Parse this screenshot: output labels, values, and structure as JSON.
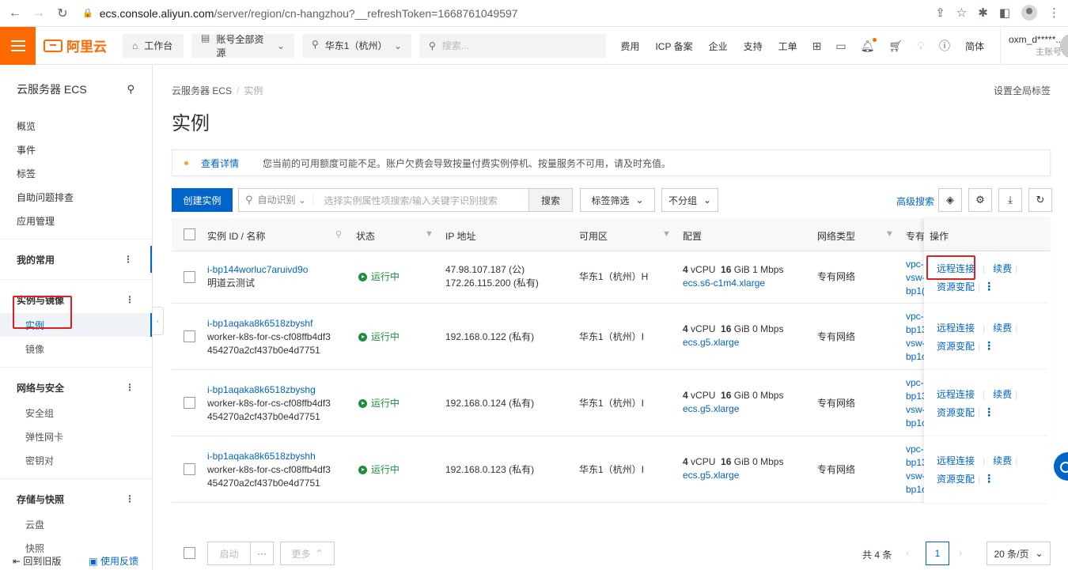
{
  "browser": {
    "url_host": "ecs.console.aliyun.com",
    "url_path": "/server/region/cn-hangzhou?__refreshToken=1668761049597"
  },
  "topbar": {
    "logo": "阿里云",
    "workbench": "工作台",
    "resources": "账号全部资源",
    "region": "华东1（杭州）",
    "search_placeholder": "搜索...",
    "links": [
      "费用",
      "ICP 备案",
      "企业",
      "支持",
      "工单"
    ],
    "lang": "简体",
    "user_name": "oxm_d*****...",
    "user_role": "主账号"
  },
  "sidebar": {
    "title": "云服务器 ECS",
    "top_items": [
      "概览",
      "事件",
      "标签",
      "自助问题排查",
      "应用管理"
    ],
    "favorites": "我的常用",
    "group_instance": "实例与镜像",
    "instance_items": [
      "实例",
      "镜像"
    ],
    "group_network": "网络与安全",
    "network_items": [
      "安全组",
      "弹性网卡",
      "密钥对"
    ],
    "group_storage": "存储与快照",
    "storage_items": [
      "云盘",
      "快照"
    ],
    "footer_old": "回到旧版",
    "footer_feedback": "使用反馈"
  },
  "main": {
    "breadcrumb_root": "云服务器 ECS",
    "breadcrumb_current": "实例",
    "global_tag": "设置全局标签",
    "title": "实例",
    "notice_link": "查看详情",
    "notice_msg": "您当前的可用额度可能不足。账户欠费会导致按量付费实例停机、按量服务不可用，请及时充值。",
    "create_btn": "创建实例",
    "search_mode": "自动识别",
    "search_placeholder": "选择实例属性项搜索/输入关键字识别搜索",
    "search_btn": "搜索",
    "tag_filter": "标签筛选",
    "group_by": "不分组",
    "advanced_search": "高级搜索"
  },
  "table": {
    "headers": {
      "id_name": "实例 ID / 名称",
      "status": "状态",
      "ip": "IP 地址",
      "zone": "可用区",
      "config": "配置",
      "net_type": "网络类型",
      "vpc": "专有",
      "ops": "操作"
    },
    "rows": [
      {
        "id": "i-bp144worluc7aruivd9o",
        "name1": "明道云测试",
        "name2": "",
        "status": "运行中",
        "ip1": "47.98.107.187 (公)",
        "ip2": "172.26.115.200 (私有)",
        "zone": "华东1（杭州）H",
        "cpu": "4",
        "cpu_unit": "vCPU",
        "mem": "16",
        "mem_unit": "GiB",
        "bw": "1 Mbps",
        "spec": "ecs.s6-c1m4.xlarge",
        "net": "专有网络",
        "vpc": [
          "vpc-",
          "vsw-",
          "bp1("
        ],
        "op_remote": "远程连接",
        "op_renew": "续费",
        "op_change": "资源变配"
      },
      {
        "id": "i-bp1aqaka8k6518zbyshf",
        "name1": "worker-k8s-for-cs-cf08ffb4df3",
        "name2": "454270a2cf437b0e4d7751",
        "status": "运行中",
        "ip1": "192.168.0.122 (私有)",
        "ip2": "",
        "zone": "华东1（杭州）I",
        "cpu": "4",
        "cpu_unit": "vCPU",
        "mem": "16",
        "mem_unit": "GiB",
        "bw": "0 Mbps",
        "spec": "ecs.g5.xlarge",
        "net": "专有网络",
        "vpc": [
          "vpc-",
          "bp13",
          "vsw-",
          "bp1c"
        ],
        "op_remote": "远程连接",
        "op_renew": "续费",
        "op_change": "资源变配"
      },
      {
        "id": "i-bp1aqaka8k6518zbyshg",
        "name1": "worker-k8s-for-cs-cf08ffb4df3",
        "name2": "454270a2cf437b0e4d7751",
        "status": "运行中",
        "ip1": "192.168.0.124 (私有)",
        "ip2": "",
        "zone": "华东1（杭州）I",
        "cpu": "4",
        "cpu_unit": "vCPU",
        "mem": "16",
        "mem_unit": "GiB",
        "bw": "0 Mbps",
        "spec": "ecs.g5.xlarge",
        "net": "专有网络",
        "vpc": [
          "vpc-",
          "bp13",
          "vsw-",
          "bp1c"
        ],
        "op_remote": "远程连接",
        "op_renew": "续费",
        "op_change": "资源变配"
      },
      {
        "id": "i-bp1aqaka8k6518zbyshh",
        "name1": "worker-k8s-for-cs-cf08ffb4df3",
        "name2": "454270a2cf437b0e4d7751",
        "status": "运行中",
        "ip1": "192.168.0.123 (私有)",
        "ip2": "",
        "zone": "华东1（杭州）I",
        "cpu": "4",
        "cpu_unit": "vCPU",
        "mem": "16",
        "mem_unit": "GiB",
        "bw": "0 Mbps",
        "spec": "ecs.g5.xlarge",
        "net": "专有网络",
        "vpc": [
          "vpc-",
          "bp13",
          "vsw-",
          "bp1c"
        ],
        "op_remote": "远程连接",
        "op_renew": "续费",
        "op_change": "资源变配"
      }
    ]
  },
  "footer": {
    "start_btn": "启动",
    "more_dots": "···",
    "more_btn": "更多",
    "total": "共 4 条",
    "current_page": "1",
    "per_page": "20 条/页"
  }
}
